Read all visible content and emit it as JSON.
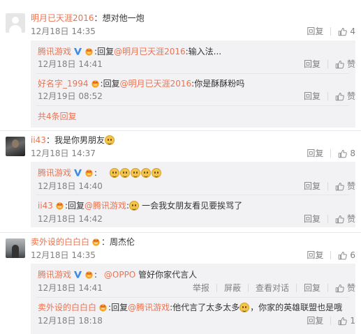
{
  "labels": {
    "reply": "回复",
    "like": "赞",
    "report": "举报",
    "block": "屏蔽",
    "view_thread": "查看对话",
    "reply_prefix": "回复",
    "colon": ":"
  },
  "colors": {
    "accent": "#eb7350",
    "vip": "#f5a623",
    "reply_bg": "#f2f2f5",
    "meta": "#808080"
  },
  "comments": [
    {
      "user": "明月已天涯2016",
      "text": "想对他一炮",
      "time": "12月18日 14:35",
      "likes": "4",
      "avatar": "default-avatar",
      "replies": [
        {
          "user": "腾讯游戏",
          "reply_to": "@明月已天涯2016",
          "text": "输入法...",
          "time": "12月18日 14:41"
        },
        {
          "user": "好名字_1994",
          "reply_to": "@明月已天涯2016",
          "text": "你是酥酥粉吗",
          "time": "12月19日 08:52"
        }
      ],
      "more_replies": "共4条回复"
    },
    {
      "user": "ii43",
      "text": "我是你男朋友",
      "time": "12月18日 14:37",
      "likes": "8",
      "avatar": "user-photo",
      "replies": [
        {
          "user": "腾讯游戏",
          "time": "12月18日 14:40"
        },
        {
          "user": "ii43",
          "reply_to": "@腾讯游戏",
          "text": "一会我女朋友看见要挨骂了",
          "time": "12月18日 14:42"
        }
      ]
    },
    {
      "user": "卖外设的白白白",
      "text": "周杰伦",
      "time": "12月18日 14:35",
      "likes": "6",
      "avatar": "user-photo",
      "replies": [
        {
          "user": "腾讯游戏",
          "mention": "@OPPO",
          "text": "管好你家代言人",
          "time": "12月18日 14:41"
        },
        {
          "user": "卖外设的白白白",
          "reply_to": "@腾讯游戏",
          "text": "他代言了太多太多",
          "text2": "，你家的英雄联盟也是哦",
          "time": "12月18日 18:18",
          "likes": "1"
        }
      ]
    }
  ]
}
